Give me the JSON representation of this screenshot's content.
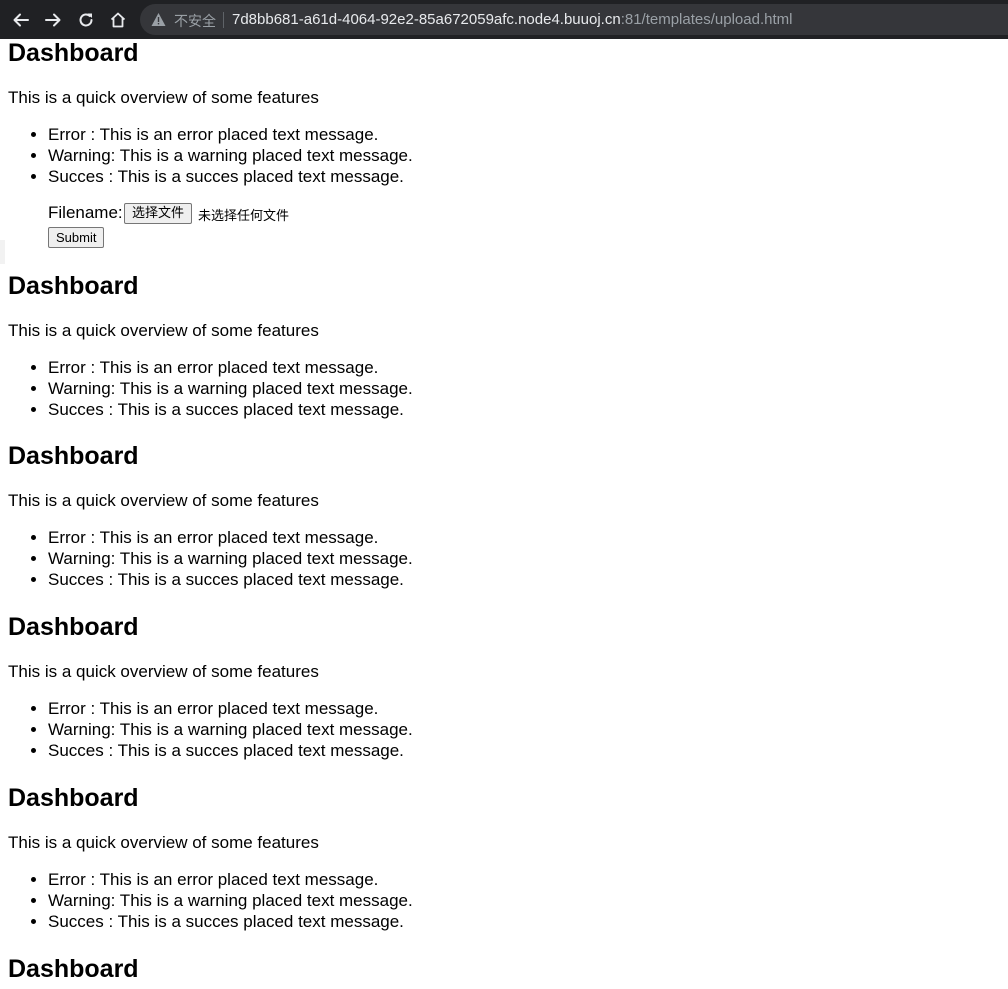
{
  "browser": {
    "insecure_label": "不安全",
    "url_host": "7d8bb681-a61d-4064-92e2-85a672059afc.node4.buuoj.cn",
    "url_rest": ":81/templates/upload.html",
    "icons": [
      "back-arrow-icon",
      "forward-arrow-icon",
      "reload-icon",
      "home-icon",
      "warning-triangle-icon"
    ]
  },
  "sections": [
    {
      "title": "Dashboard",
      "intro": "This is a quick overview of some features",
      "items": [
        "Error : This is an error placed text message.",
        "Warning: This is a warning placed text message.",
        "Succes : This is a succes placed text message."
      ]
    },
    {
      "title": "Dashboard",
      "intro": "This is a quick overview of some features",
      "items": [
        "Error : This is an error placed text message.",
        "Warning: This is a warning placed text message.",
        "Succes : This is a succes placed text message."
      ]
    },
    {
      "title": "Dashboard",
      "intro": "This is a quick overview of some features",
      "items": [
        "Error : This is an error placed text message.",
        "Warning: This is a warning placed text message.",
        "Succes : This is a succes placed text message."
      ]
    },
    {
      "title": "Dashboard",
      "intro": "This is a quick overview of some features",
      "items": [
        "Error : This is an error placed text message.",
        "Warning: This is a warning placed text message.",
        "Succes : This is a succes placed text message."
      ]
    },
    {
      "title": "Dashboard",
      "intro": "This is a quick overview of some features",
      "items": [
        "Error : This is an error placed text message.",
        "Warning: This is a warning placed text message.",
        "Succes : This is a succes placed text message."
      ]
    },
    {
      "title": "Dashboard"
    }
  ],
  "upload_form": {
    "filename_label": "Filename:",
    "choose_file_label": "选择文件",
    "no_file_label": "未选择任何文件",
    "submit_label": "Submit"
  }
}
